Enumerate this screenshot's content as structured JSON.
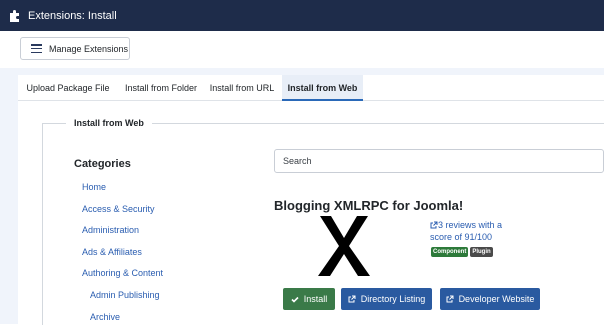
{
  "header": {
    "title": "Extensions: Install",
    "icon": "puzzle-icon"
  },
  "toolbar": {
    "manage_label": "Manage Extensions",
    "manage_icon": "list-icon"
  },
  "tabs": [
    {
      "label": "Upload Package File"
    },
    {
      "label": "Install from Folder"
    },
    {
      "label": "Install from URL"
    },
    {
      "label": "Install from Web",
      "active": true
    }
  ],
  "section": {
    "legend": "Install from Web"
  },
  "categories": {
    "title": "Categories",
    "items": [
      {
        "label": "Home",
        "level": 0
      },
      {
        "label": "Access & Security",
        "level": 0
      },
      {
        "label": "Administration",
        "level": 0
      },
      {
        "label": "Ads & Affiliates",
        "level": 0
      },
      {
        "label": "Authoring & Content",
        "level": 0
      },
      {
        "label": "Admin Publishing",
        "level": 1
      },
      {
        "label": "Archive",
        "level": 1
      }
    ]
  },
  "search": {
    "placeholder": "Search",
    "value": ""
  },
  "extension": {
    "title": "Blogging XMLRPC for Joomla!",
    "image_icon": "x-placeholder-icon",
    "reviews_text": "3 reviews with a score of 91/100",
    "reviews_icon": "external-link-icon",
    "badges": [
      {
        "label": "Component",
        "color": "#2d7a3a"
      },
      {
        "label": "Plugin",
        "color": "#4a4a4a"
      }
    ],
    "actions": {
      "install": {
        "label": "Install",
        "icon": "check-icon",
        "color": "#3a7a48"
      },
      "directory": {
        "label": "Directory Listing",
        "icon": "external-link-icon",
        "color": "#2a5aa0"
      },
      "developer": {
        "label": "Developer Website",
        "icon": "external-link-icon",
        "color": "#2a5aa0"
      }
    }
  },
  "colors": {
    "header_bg": "#1e2c4a",
    "link": "#2a5db0",
    "active_tab_border": "#2a69b8"
  }
}
